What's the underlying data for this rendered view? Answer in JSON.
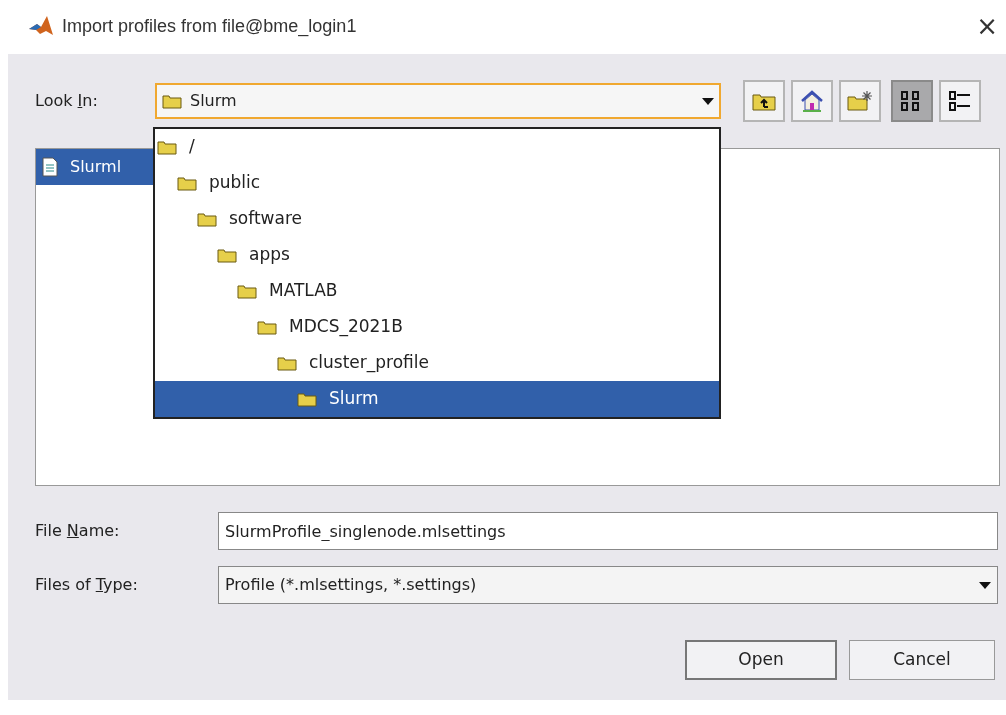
{
  "window": {
    "title": "Import profiles from file@bme_login1",
    "close": "×"
  },
  "look_in": {
    "label": {
      "before": "Look ",
      "key": "I",
      "after": "n:"
    },
    "value": "Slurm",
    "expanded": true
  },
  "toolbar": [
    {
      "kind": "up",
      "selected": false
    },
    {
      "kind": "home",
      "selected": false
    },
    {
      "kind": "new-folder",
      "selected": false
    },
    {
      "kind": "list",
      "selected": true
    },
    {
      "kind": "details",
      "selected": false
    }
  ],
  "files": [
    {
      "name": "Slurml",
      "selected": true
    }
  ],
  "dropdown": [
    {
      "name": "/",
      "selected": false,
      "children": [
        {
          "name": "public",
          "selected": false,
          "children": [
            {
              "name": "software",
              "selected": false,
              "children": [
                {
                  "name": "apps",
                  "selected": false,
                  "children": [
                    {
                      "name": "MATLAB",
                      "selected": false,
                      "children": [
                        {
                          "name": "MDCS_2021B",
                          "selected": false,
                          "children": [
                            {
                              "name": "cluster_profile",
                              "selected": false,
                              "children": [
                                {
                                  "name": "Slurm",
                                  "selected": true
                                }
                              ]
                            }
                          ]
                        }
                      ]
                    }
                  ]
                }
              ]
            }
          ]
        }
      ]
    }
  ],
  "file_name": {
    "label": {
      "before": "File ",
      "key": "N",
      "after": "ame:"
    },
    "value": "SlurmProfile_singlenode.mlsettings"
  },
  "file_type": {
    "label": {
      "before": "Files of ",
      "key": "T",
      "after": "ype:"
    },
    "value": "Profile (*.mlsettings, *.settings)"
  },
  "buttons": [
    {
      "label": "Open",
      "default": true
    },
    {
      "label": "Cancel",
      "default": false
    }
  ]
}
